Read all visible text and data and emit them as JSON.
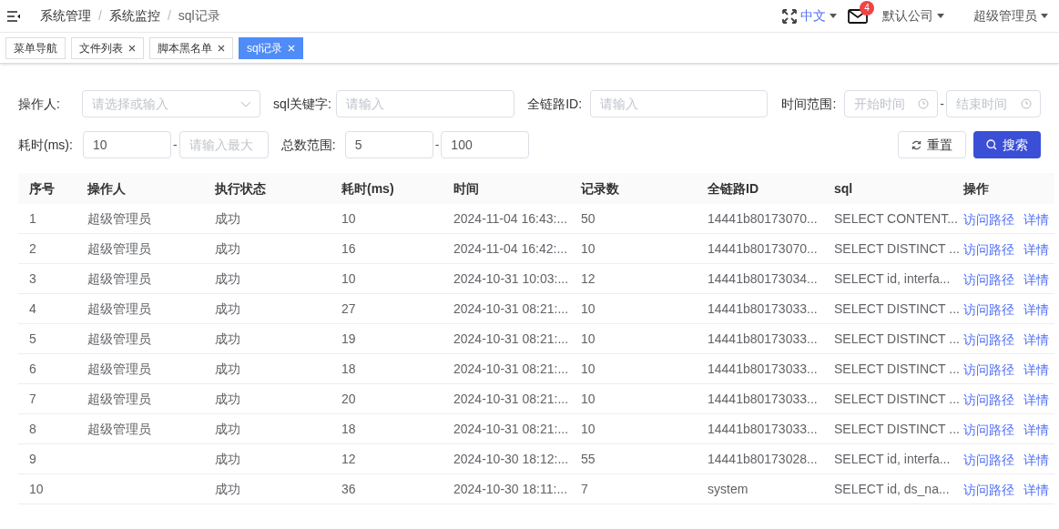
{
  "breadcrumb": {
    "items": [
      "系统管理",
      "系统监控",
      "sql记录"
    ],
    "separators": [
      "/",
      "/"
    ]
  },
  "header": {
    "language": "中文",
    "mail_badge": "4",
    "company": "默认公司",
    "user": "超级管理员"
  },
  "tabs": [
    {
      "label": "菜单导航",
      "selected": false,
      "closable": false
    },
    {
      "label": "文件列表",
      "selected": false,
      "closable": true
    },
    {
      "label": "脚本黑名单",
      "selected": false,
      "closable": true
    },
    {
      "label": "sql记录",
      "selected": true,
      "closable": true
    }
  ],
  "filters": {
    "operator": {
      "label": "操作人:",
      "placeholder": "请选择或输入"
    },
    "keyword": {
      "label": "sql关键字:",
      "placeholder": "请输入"
    },
    "trace_id": {
      "label": "全链路ID:",
      "placeholder": "请输入"
    },
    "time_range": {
      "label": "时间范围:",
      "start_placeholder": "开始时间",
      "separator": "-",
      "end_placeholder": "结束时间"
    },
    "duration": {
      "label": "耗时(ms):",
      "min_value": "10",
      "separator": "-",
      "max_placeholder": "请输入最大"
    },
    "count_range": {
      "label": "总数范围:",
      "min_value": "5",
      "separator": "-",
      "max_value": "100"
    }
  },
  "buttons": {
    "reset": "重置",
    "search": "搜索"
  },
  "table": {
    "columns": [
      "序号",
      "操作人",
      "执行状态",
      "耗时(ms)",
      "时间",
      "记录数",
      "全链路ID",
      "sql",
      "操作"
    ],
    "rows": [
      {
        "cells": [
          "1",
          "超级管理员",
          "成功",
          "10",
          "2024-11-04 16:43:...",
          "50",
          "14441b80173070...",
          "SELECT CONTENT..."
        ],
        "actions": [
          "访问路径",
          "详情"
        ]
      },
      {
        "cells": [
          "2",
          "超级管理员",
          "成功",
          "16",
          "2024-11-04 16:42:...",
          "10",
          "14441b80173070...",
          "SELECT DISTINCT ..."
        ],
        "actions": [
          "访问路径",
          "详情"
        ]
      },
      {
        "cells": [
          "3",
          "超级管理员",
          "成功",
          "10",
          "2024-10-31 10:03:...",
          "12",
          "14441b80173034...",
          "SELECT id, interfa..."
        ],
        "actions": [
          "访问路径",
          "详情"
        ]
      },
      {
        "cells": [
          "4",
          "超级管理员",
          "成功",
          "27",
          "2024-10-31 08:21:...",
          "10",
          "14441b80173033...",
          "SELECT DISTINCT ..."
        ],
        "actions": [
          "访问路径",
          "详情"
        ]
      },
      {
        "cells": [
          "5",
          "超级管理员",
          "成功",
          "19",
          "2024-10-31 08:21:...",
          "10",
          "14441b80173033...",
          "SELECT DISTINCT ..."
        ],
        "actions": [
          "访问路径",
          "详情"
        ]
      },
      {
        "cells": [
          "6",
          "超级管理员",
          "成功",
          "18",
          "2024-10-31 08:21:...",
          "10",
          "14441b80173033...",
          "SELECT DISTINCT ..."
        ],
        "actions": [
          "访问路径",
          "详情"
        ]
      },
      {
        "cells": [
          "7",
          "超级管理员",
          "成功",
          "20",
          "2024-10-31 08:21:...",
          "10",
          "14441b80173033...",
          "SELECT DISTINCT ..."
        ],
        "actions": [
          "访问路径",
          "详情"
        ]
      },
      {
        "cells": [
          "8",
          "超级管理员",
          "成功",
          "18",
          "2024-10-31 08:21:...",
          "10",
          "14441b80173033...",
          "SELECT DISTINCT ..."
        ],
        "actions": [
          "访问路径",
          "详情"
        ]
      },
      {
        "cells": [
          "9",
          "",
          "成功",
          "12",
          "2024-10-30 18:12:...",
          "55",
          "14441b80173028...",
          "SELECT id, interfa..."
        ],
        "actions": [
          "访问路径",
          "详情"
        ]
      },
      {
        "cells": [
          "10",
          "",
          "成功",
          "36",
          "2024-10-30 18:11:...",
          "7",
          "system",
          "SELECT id, ds_na..."
        ],
        "actions": [
          "访问路径",
          "详情"
        ]
      }
    ]
  }
}
